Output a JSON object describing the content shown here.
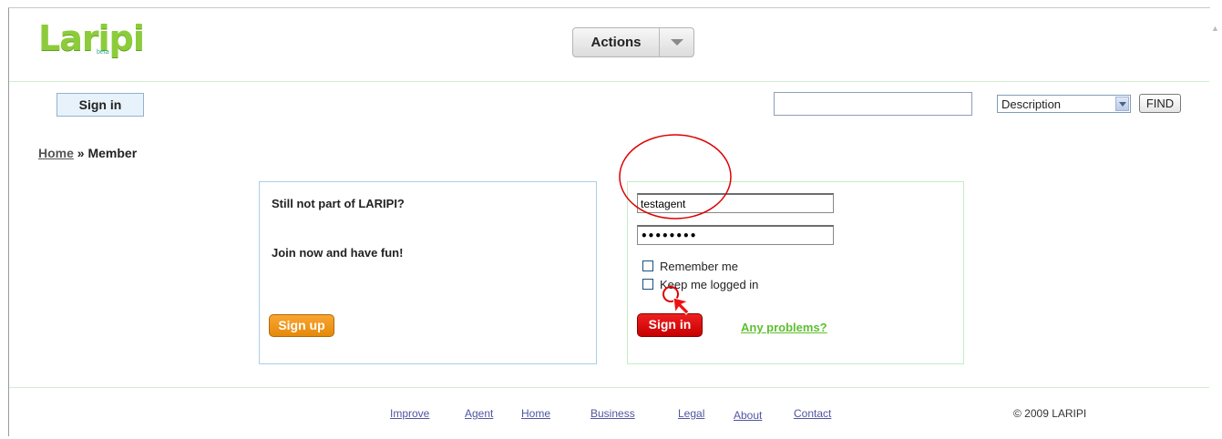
{
  "header": {
    "logo_text": "Laripi",
    "logo_tag": "beta",
    "actions_label": "Actions"
  },
  "topbar": {
    "signin_label": "Sign in",
    "search_value": "",
    "select_value": "Description",
    "find_label": "FIND"
  },
  "breadcrumb": {
    "home": "Home",
    "separator": "»",
    "current": "Member"
  },
  "join": {
    "question": "Still not part of LARIPI?",
    "cta_text": "Join now and have fun!",
    "signup_label": "Sign up"
  },
  "login": {
    "username_value": "testagent",
    "password_value": "••••••••",
    "remember_label": "Remember me",
    "remember_checked": false,
    "keep_label": "Keep me logged in",
    "keep_checked": false,
    "signin_label": "Sign in",
    "problems_label": "Any problems?"
  },
  "footer": {
    "links": [
      "Improve",
      "Agent",
      "Home",
      "Business",
      "Legal",
      "About",
      "Contact"
    ],
    "copyright": "© 2009 LARIPI"
  },
  "colors": {
    "logo": "#8ccc3a",
    "signup": "#f0960f",
    "signin": "#dd0b0b",
    "problems": "#5cbf2f",
    "annotation": "#dd0000"
  },
  "icons": {
    "actions_caret": "chevron-down-icon",
    "select_arrow": "dropdown-arrow-icon",
    "annotation_pointer": "arrow-cursor-icon"
  }
}
